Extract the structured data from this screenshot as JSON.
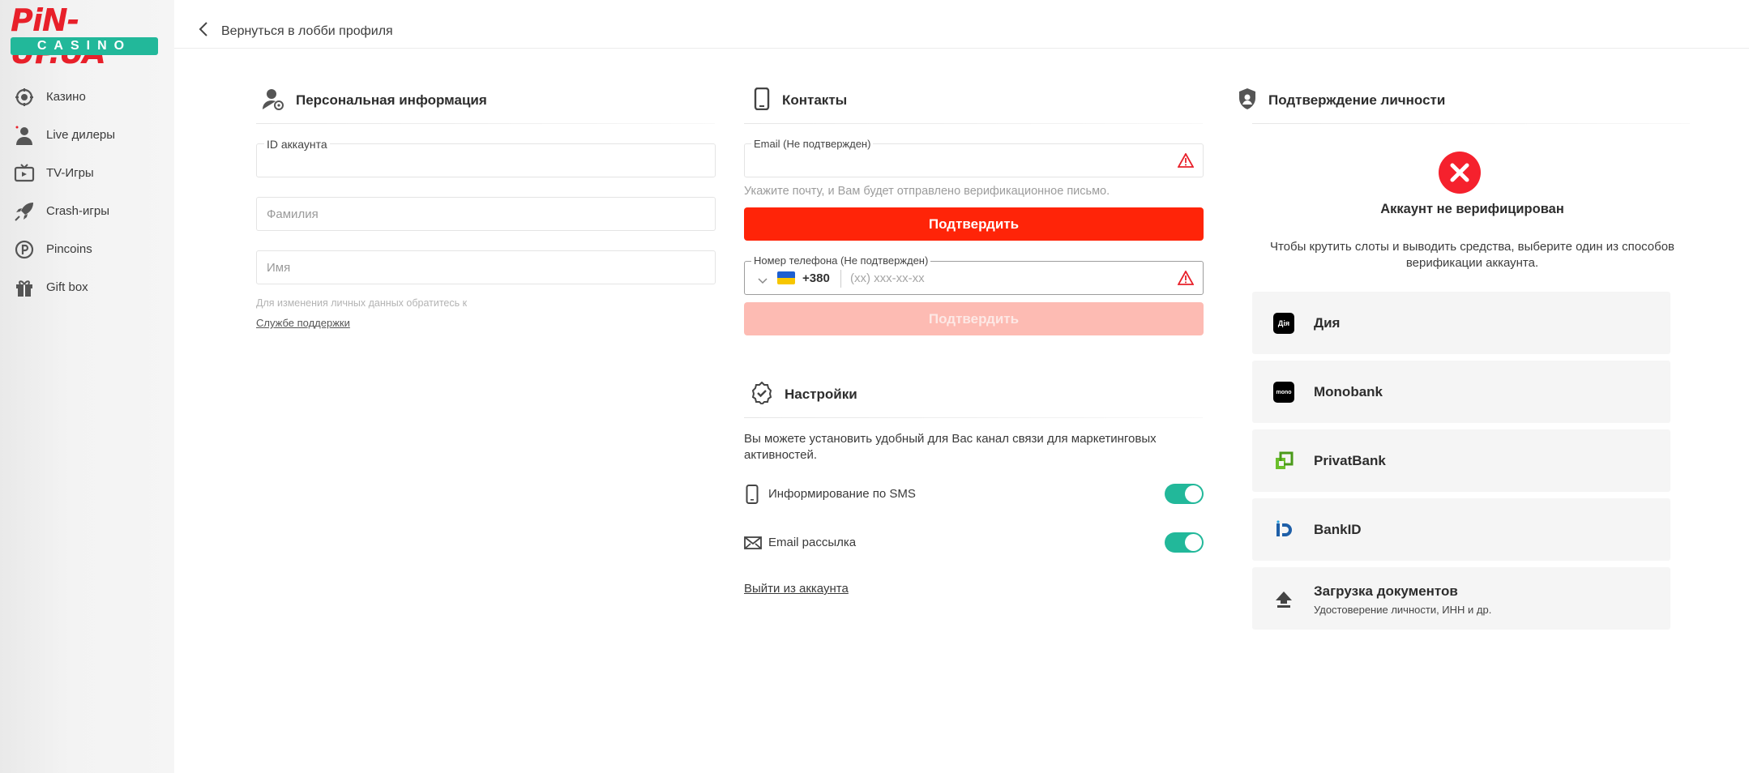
{
  "brand": {
    "name": "PiN-UP.UA",
    "sub": "CASINO",
    "red": "#e8202a",
    "green": "#22b89a"
  },
  "sidebar": {
    "items": [
      {
        "label": "Казино",
        "icon": "casino-chip-icon"
      },
      {
        "label": "Live дилеры",
        "icon": "dealer-icon"
      },
      {
        "label": "TV-Игры",
        "icon": "tv-icon"
      },
      {
        "label": "Crash-игры",
        "icon": "rocket-icon"
      },
      {
        "label": "Pincoins",
        "icon": "coin-icon"
      },
      {
        "label": "Gift box",
        "icon": "gift-icon"
      }
    ]
  },
  "topbar": {
    "back_label": "Вернуться в лобби профиля"
  },
  "personal": {
    "title": "Персональная информация",
    "account_id_label": "ID аккаунта",
    "surname_placeholder": "Фамилия",
    "name_placeholder": "Имя",
    "note": "Для изменения личных данных обратитесь к",
    "support_link": "Службе поддержки"
  },
  "contacts": {
    "title": "Контакты",
    "email_label": "Email (Не подтвержден)",
    "email_hint": "Укажите почту, и Вам будет отправлено верификационное письмо.",
    "confirm_label": "Подтвердить",
    "phone_label": "Номер телефона (Не подтвержден)",
    "phone_code": "+380",
    "phone_placeholder": "(xx) xxx-xx-xx",
    "confirm_phone_label": "Подтвердить"
  },
  "settings": {
    "title": "Настройки",
    "description": "Вы можете установить удобный для Вас канал связи для маркетинговых активностей.",
    "sms_label": "Информирование по SMS",
    "email_label": "Email рассылка",
    "sms_enabled": true,
    "email_enabled": true,
    "logout_label": "Выйти из аккаунта"
  },
  "verification": {
    "title": "Подтверждение личности",
    "status": "Аккаунт не верифицирован",
    "description": "Чтобы крутить слоты и выводить средства, выберите один из способов верификации аккаунта.",
    "methods": [
      {
        "label": "Дия",
        "icon": "diia-icon",
        "icon_text": "Дія"
      },
      {
        "label": "Monobank",
        "icon": "monobank-icon",
        "icon_text": "mono"
      },
      {
        "label": "PrivatBank",
        "icon": "privatbank-icon"
      },
      {
        "label": "BankID",
        "icon": "bankid-icon"
      },
      {
        "label": "Загрузка документов",
        "sub": "Удостоверение личности, ИНН и др.",
        "icon": "upload-icon"
      }
    ]
  }
}
